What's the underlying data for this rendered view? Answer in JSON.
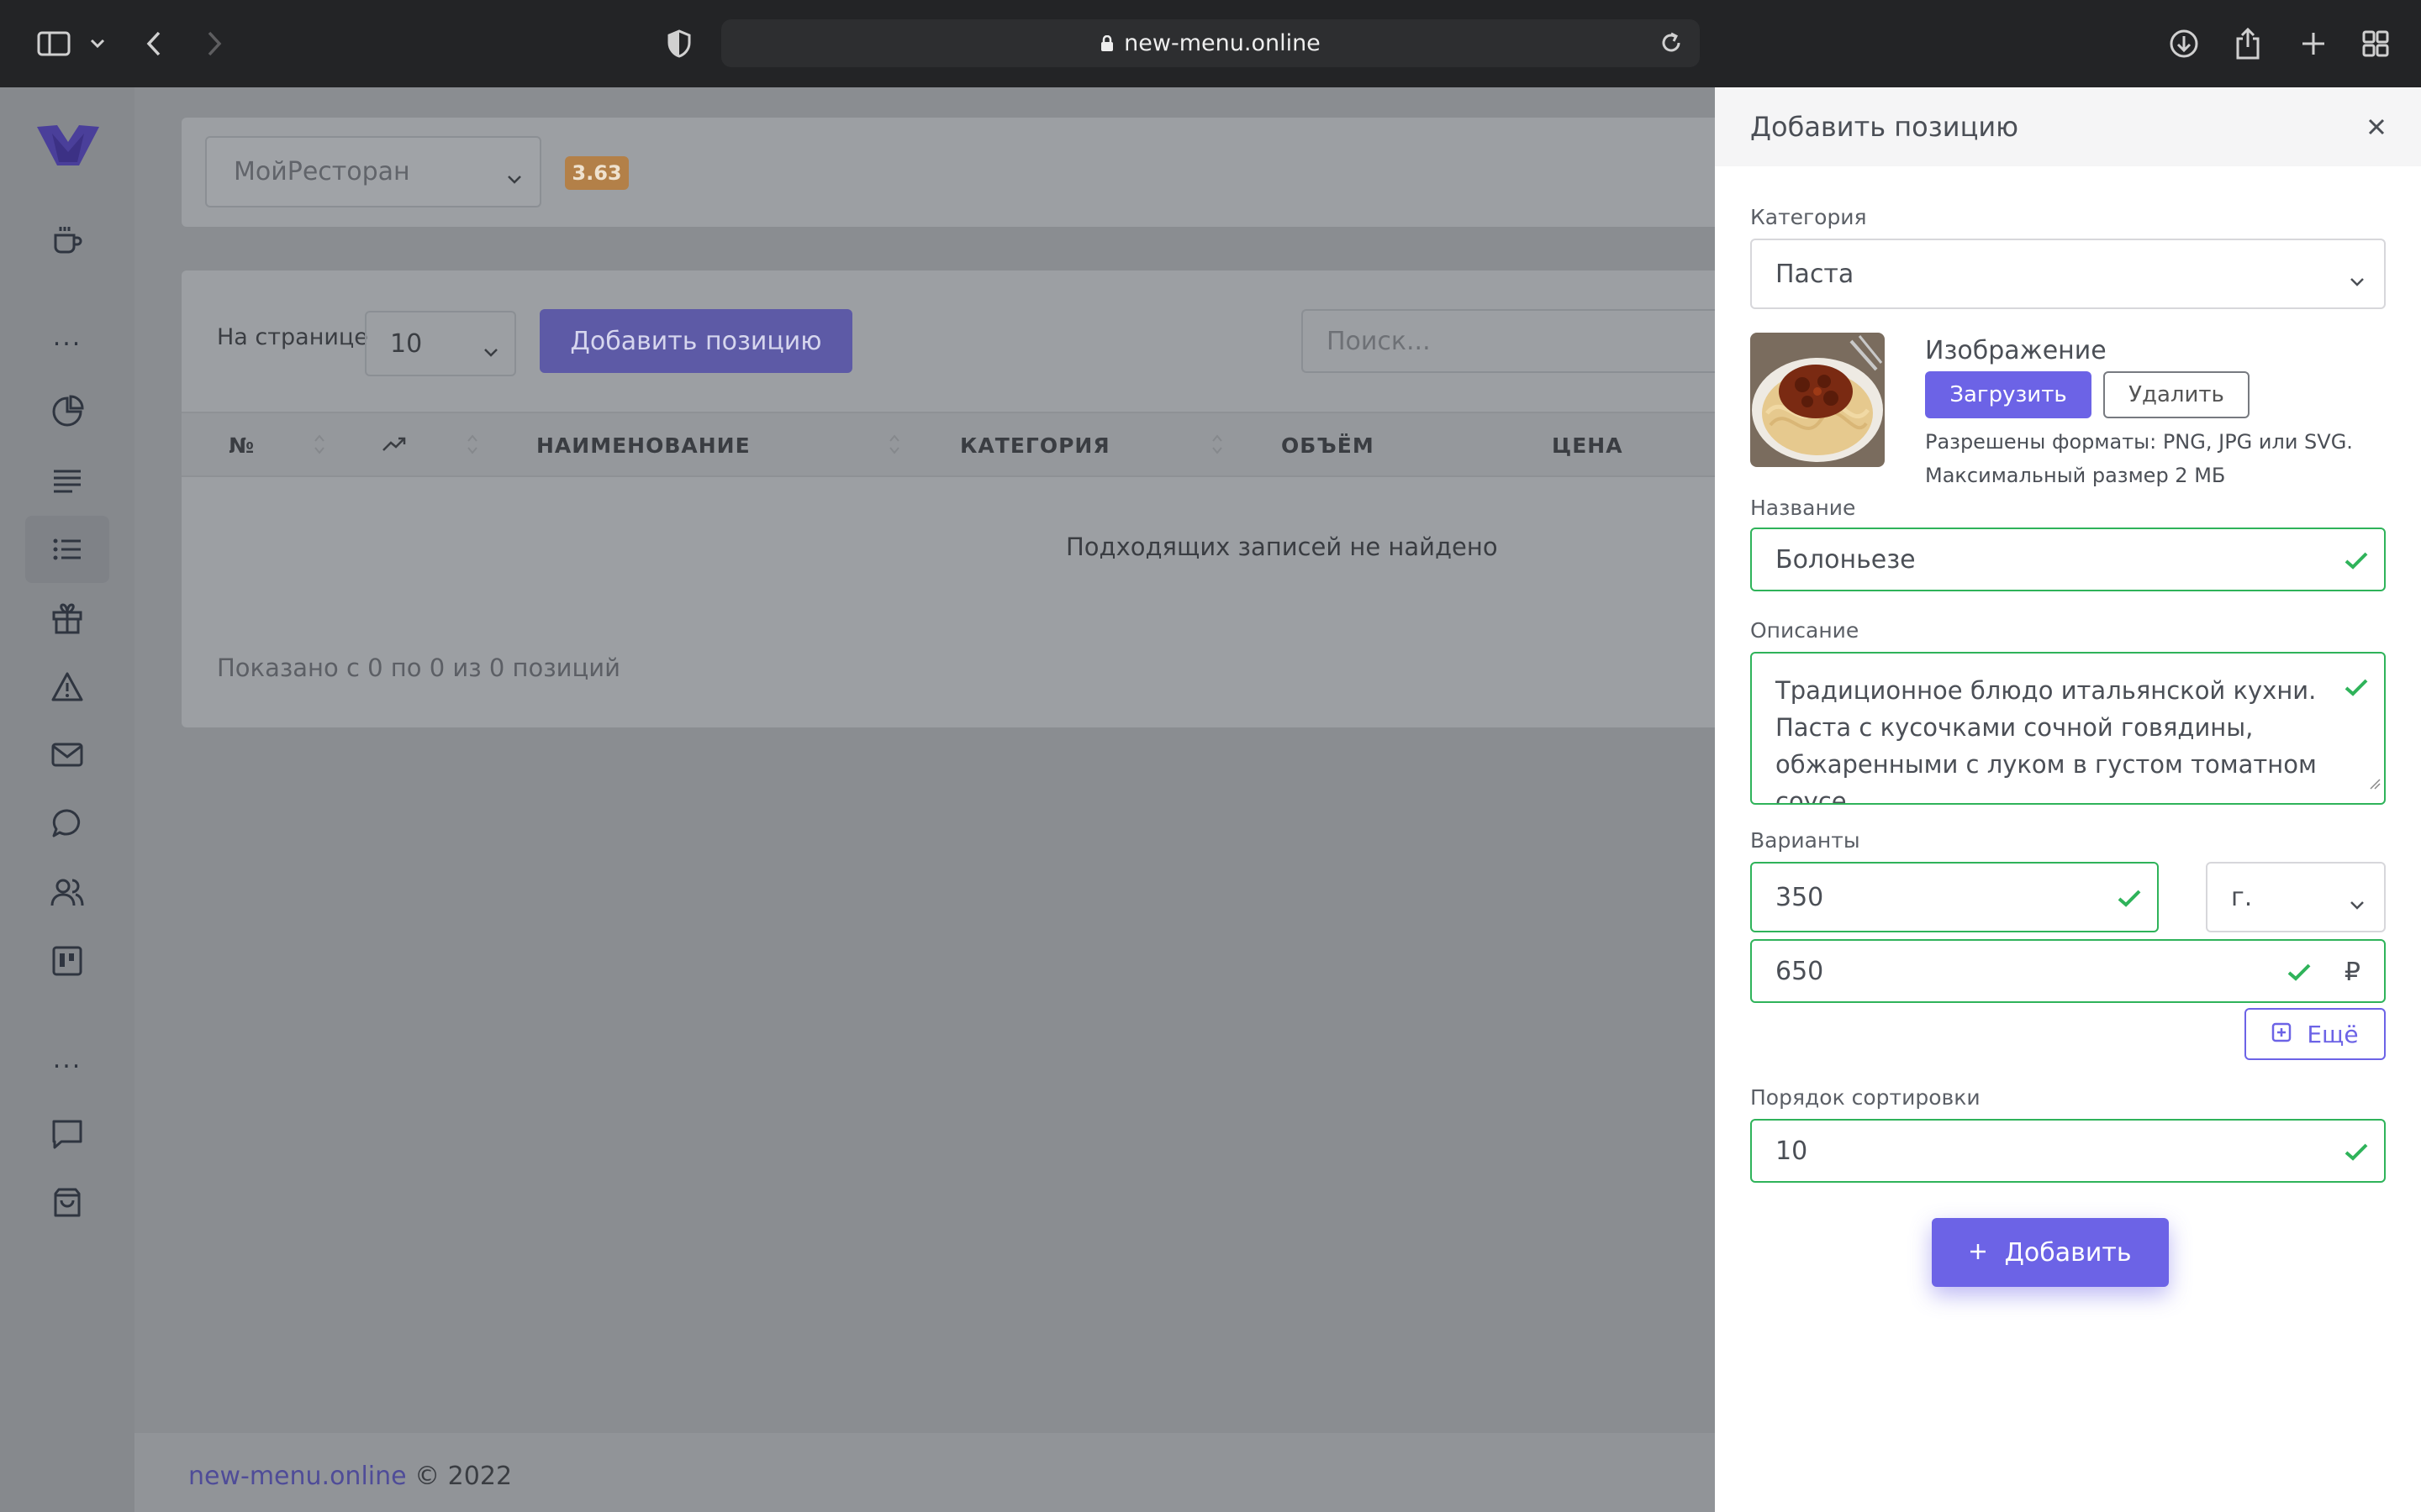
{
  "browser": {
    "url": "new-menu.online"
  },
  "header": {
    "restaurant_select": "МойРесторан",
    "version_badge": "3.63"
  },
  "toolbar": {
    "per_page_label": "На странице",
    "per_page_value": "10",
    "add_position_label": "Добавить позицию",
    "search_placeholder": "Поиск..."
  },
  "table": {
    "columns": [
      "№",
      "НАИМЕНОВАНИЕ",
      "КАТЕГОРИЯ",
      "ОБЪЁМ",
      "ЦЕНА"
    ],
    "empty_message": "Подходящих записей не найдено",
    "shown_message": "Показано с 0 по 0 из 0 позиций"
  },
  "footer": {
    "link": "new-menu.online",
    "copyright": "© 2022"
  },
  "sidebar": {
    "dots": "...",
    "icons": [
      "coffee-cup-icon",
      "pie-chart-icon",
      "text-lines-icon",
      "list-icon",
      "gift-icon",
      "warning-icon",
      "mail-icon",
      "chat-bubble-icon",
      "users-icon",
      "kanban-icon",
      "message-square-icon",
      "shopping-bag-icon"
    ],
    "active": "list-icon"
  },
  "panel": {
    "title": "Добавить позицию",
    "category_label": "Категория",
    "category_value": "Паста",
    "image_label": "Изображение",
    "upload_label": "Загрузить",
    "delete_label": "Удалить",
    "formats_text": "Разрешены форматы: PNG, JPG или SVG.",
    "max_size_text": "Максимальный размер 2 МБ",
    "name_label": "Название",
    "name_value": "Болоньезе",
    "description_label": "Описание",
    "description_value": "Традиционное блюдо итальянской кухни. Паста с кусочками сочной говядины, обжаренными с луком в густом томатном соусе.",
    "variants_label": "Варианты",
    "variant_volume": "350",
    "variant_unit": "г.",
    "variant_price": "650",
    "currency": "₽",
    "more_label": "Ещё",
    "sort_label": "Порядок сортировки",
    "sort_value": "10",
    "submit_label": "Добавить"
  },
  "colors": {
    "accent": "#6c63e6",
    "success": "#2fb35a",
    "badge": "#b38048"
  }
}
